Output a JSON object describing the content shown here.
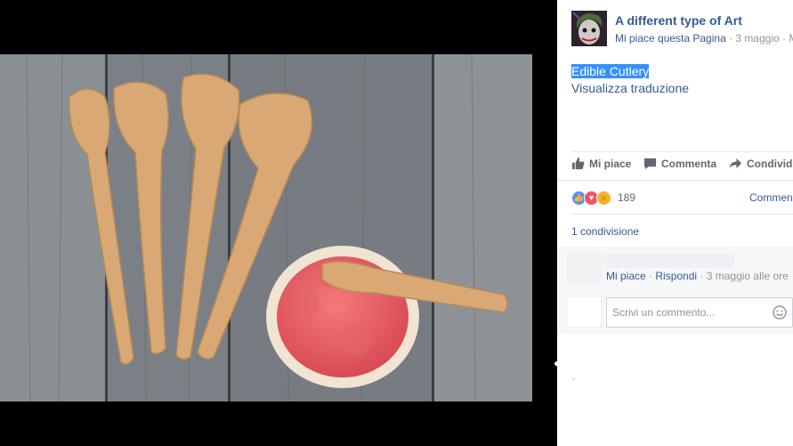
{
  "post": {
    "page_name": "A different type of Art",
    "like_page": "Mi piace questa Pagina",
    "separator": " · ",
    "date": "3 maggio",
    "meta_tail": " · M",
    "text": "Edible Cutlery",
    "translate": "Visualizza traduzione"
  },
  "actions": {
    "like": "Mi piace",
    "comment": "Commenta",
    "share": "Condivid"
  },
  "reactions": {
    "count": "189",
    "comments_link": "Commen",
    "shares": "1 condivisione"
  },
  "comment": {
    "like": "Mi piace",
    "reply": "Rispondi",
    "date": "3 maggio alle ore"
  },
  "composer": {
    "placeholder": "Scrivi un commento..."
  },
  "colors": {
    "link": "#365899",
    "muted": "#90949c",
    "like_blue": "#5890ff",
    "love_red": "#f25268",
    "wow_yellow": "#f7b125",
    "highlight": "#3390ff"
  }
}
